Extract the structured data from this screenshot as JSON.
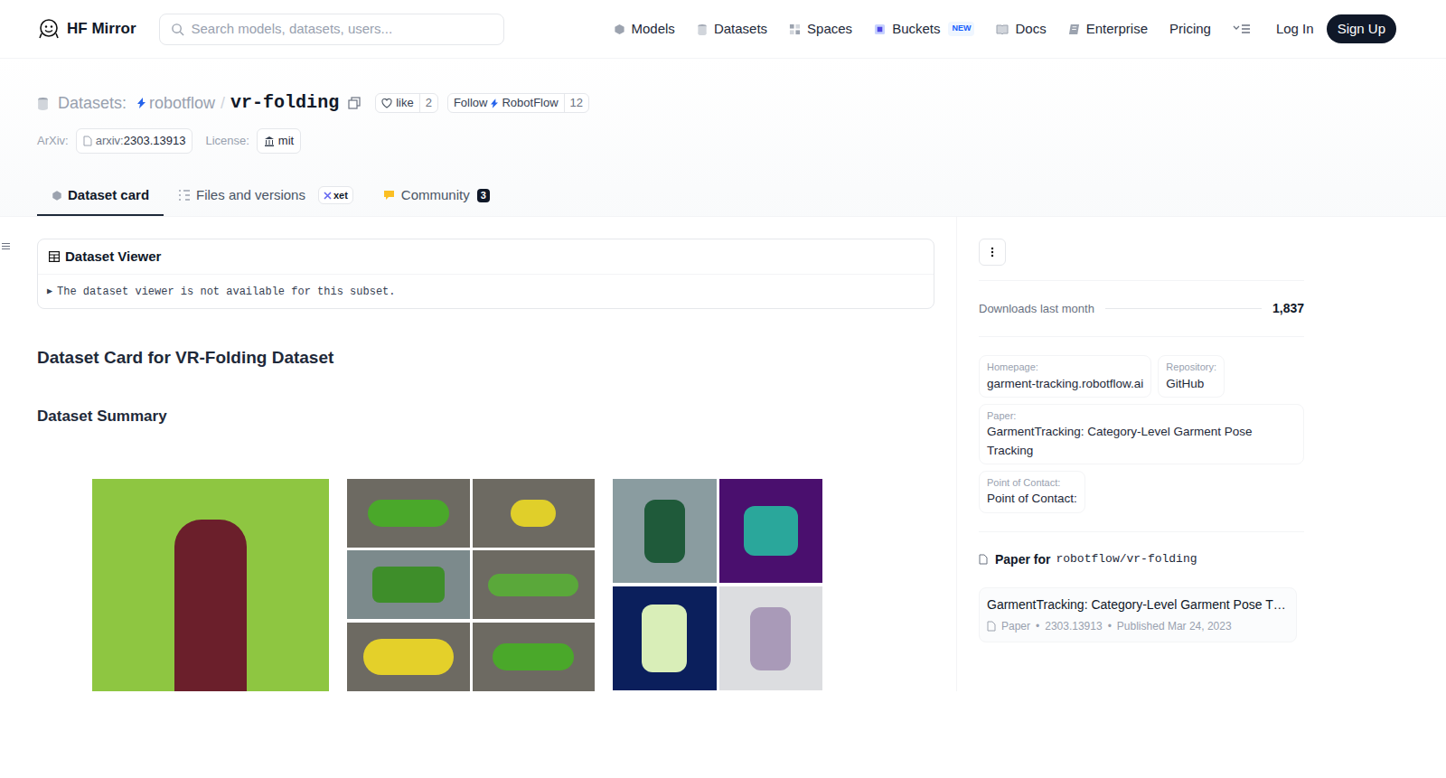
{
  "header": {
    "logo": "HF Mirror",
    "search": {
      "placeholder": "Search models, datasets, users..."
    },
    "nav": [
      {
        "label": "Models"
      },
      {
        "label": "Datasets"
      },
      {
        "label": "Spaces"
      },
      {
        "label": "Buckets",
        "badge": "NEW"
      },
      {
        "label": "Docs"
      },
      {
        "label": "Enterprise"
      },
      {
        "label": "Pricing"
      }
    ],
    "login": "Log In",
    "signup": "Sign Up"
  },
  "repo": {
    "type_label": "Datasets:",
    "owner": "robotflow",
    "separator": "/",
    "name": "vr-folding",
    "like_label": "like",
    "likes": "2",
    "follow_label": "Follow",
    "follow_org": "RobotFlow",
    "followers": "12"
  },
  "meta": [
    {
      "label": "ArXiv:",
      "prefix": "arxiv:",
      "value": "2303.13913"
    },
    {
      "label": "License:",
      "value": "mit"
    }
  ],
  "tabs": [
    {
      "label": "Dataset card",
      "selected": true
    },
    {
      "label": "Files and versions",
      "selected": false,
      "badge": {
        "text": "xet",
        "kind": "outline"
      }
    },
    {
      "label": "Community",
      "selected": false,
      "badge": {
        "text": "3",
        "kind": "count"
      }
    }
  ],
  "viewer": {
    "title": "Dataset Viewer",
    "toggle": "▶",
    "message": "The dataset viewer is not available for this subset."
  },
  "card": {
    "title": "Dataset Card for VR-Folding Dataset",
    "section": "Dataset Summary"
  },
  "sidebar": {
    "downloads": {
      "label": "Downloads last month",
      "value": "1,837"
    },
    "links": [
      {
        "label": "Homepage:",
        "value": "garment-tracking.robotflow.ai"
      },
      {
        "label": "Repository:",
        "value": "GitHub"
      },
      {
        "label": "Paper:",
        "value": "GarmentTracking: Category-Level Garment Pose Tracking"
      },
      {
        "label": "Point of Contact:",
        "value": "Point of Contact:"
      }
    ],
    "paper": {
      "heading": "Paper for",
      "repo": "robotflow/vr-folding",
      "card": {
        "title": "GarmentTracking: Category-Level Garment Pose T…",
        "kind": "Paper",
        "separator": "•",
        "id": "2303.13913",
        "published": "Published Mar 24, 2023"
      }
    }
  }
}
